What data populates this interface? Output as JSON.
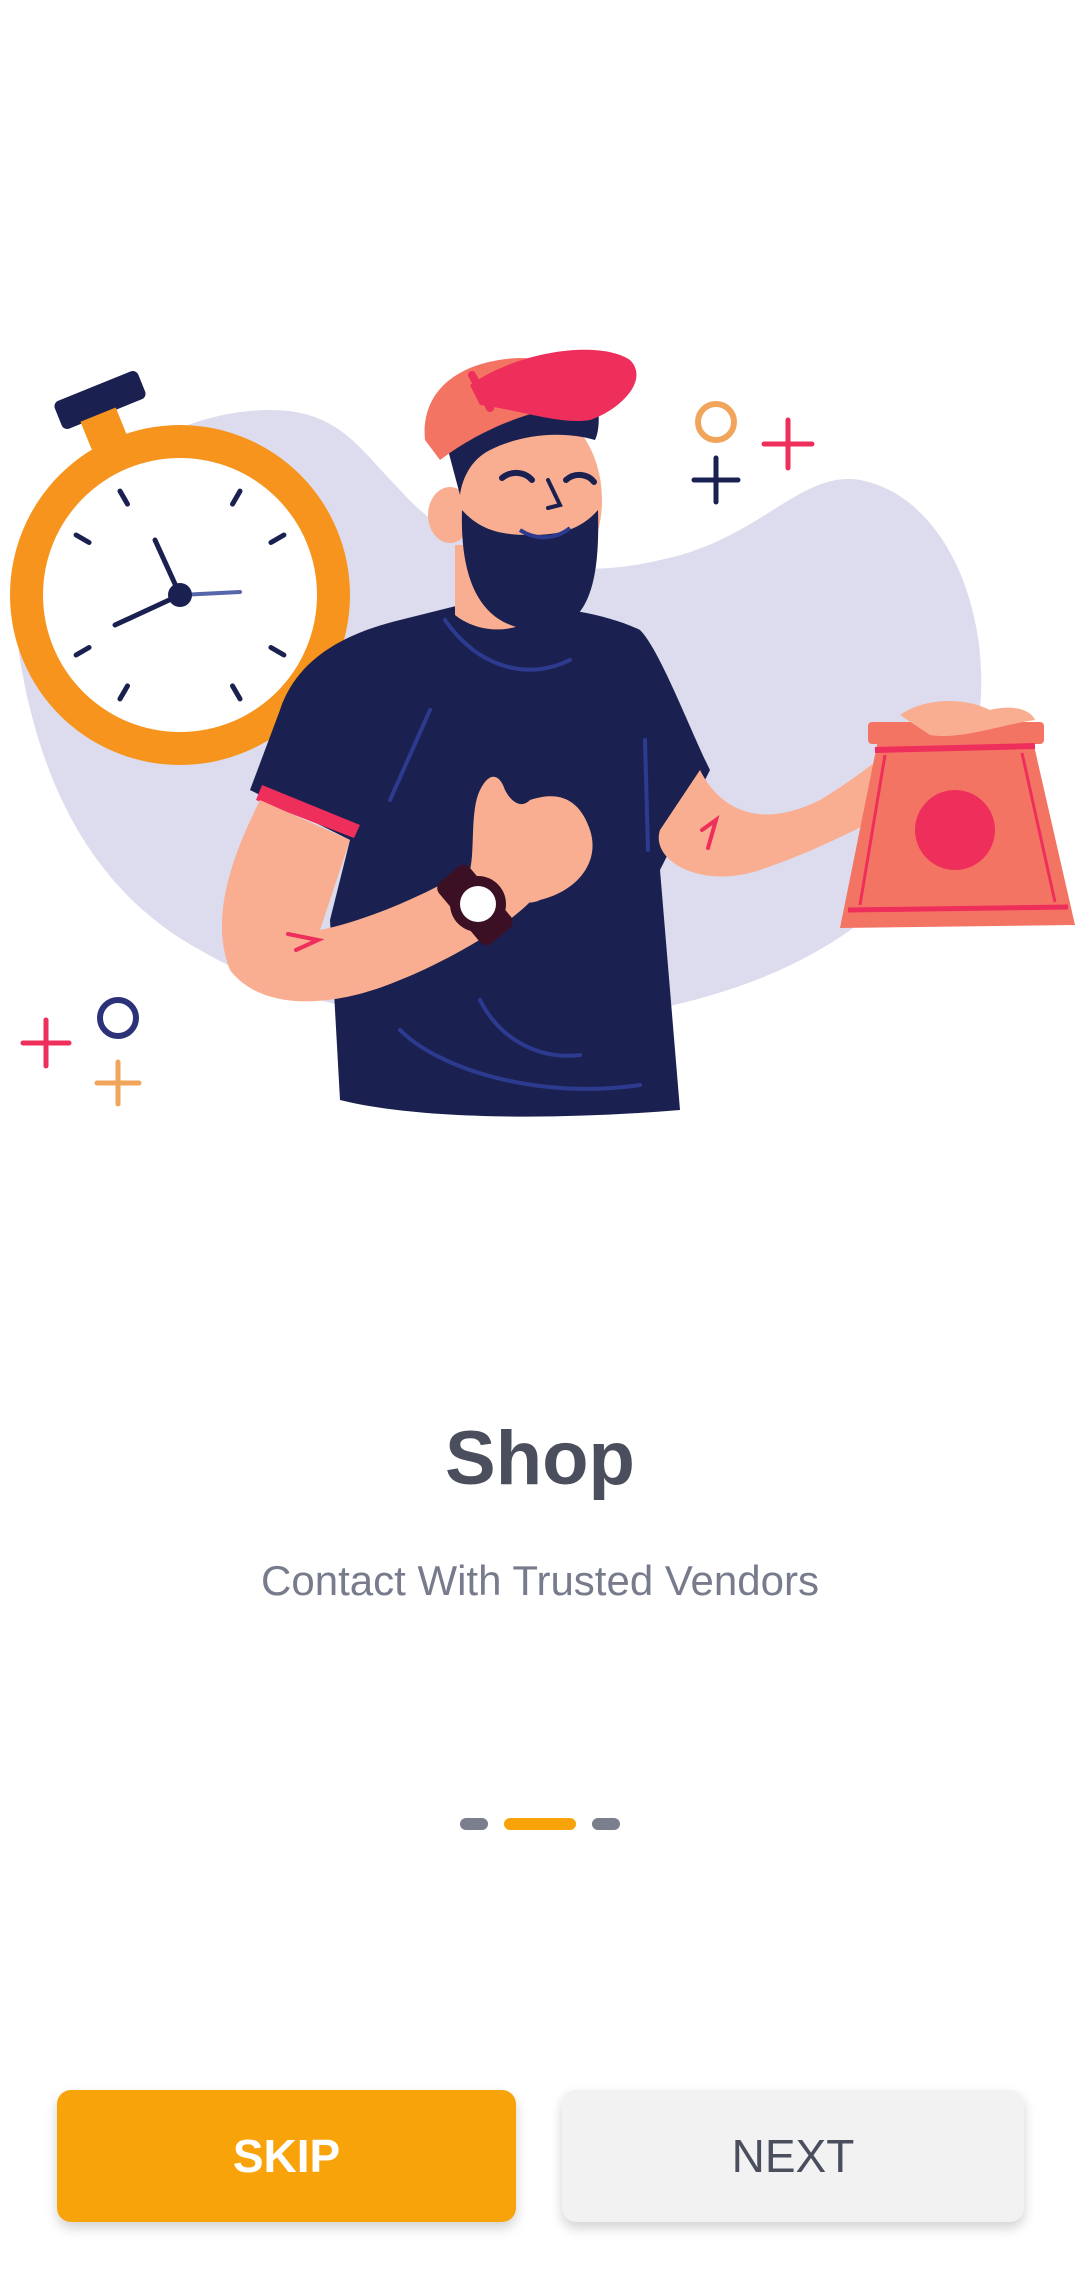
{
  "onboarding": {
    "title": "Shop",
    "subtitle": "Contact With Trusted Vendors",
    "pager": {
      "total": 3,
      "active_index": 1
    },
    "buttons": {
      "skip_label": "SKIP",
      "next_label": "NEXT"
    },
    "illustration": {
      "icon": "delivery-man-with-stopwatch-illustration"
    }
  },
  "colors": {
    "accent": "#F9A30B",
    "title_text": "#4A4E5D",
    "subtitle_text": "#777B8C",
    "navy": "#1A2150",
    "red": "#EE2E5B",
    "blob": "#DCDCEE"
  }
}
